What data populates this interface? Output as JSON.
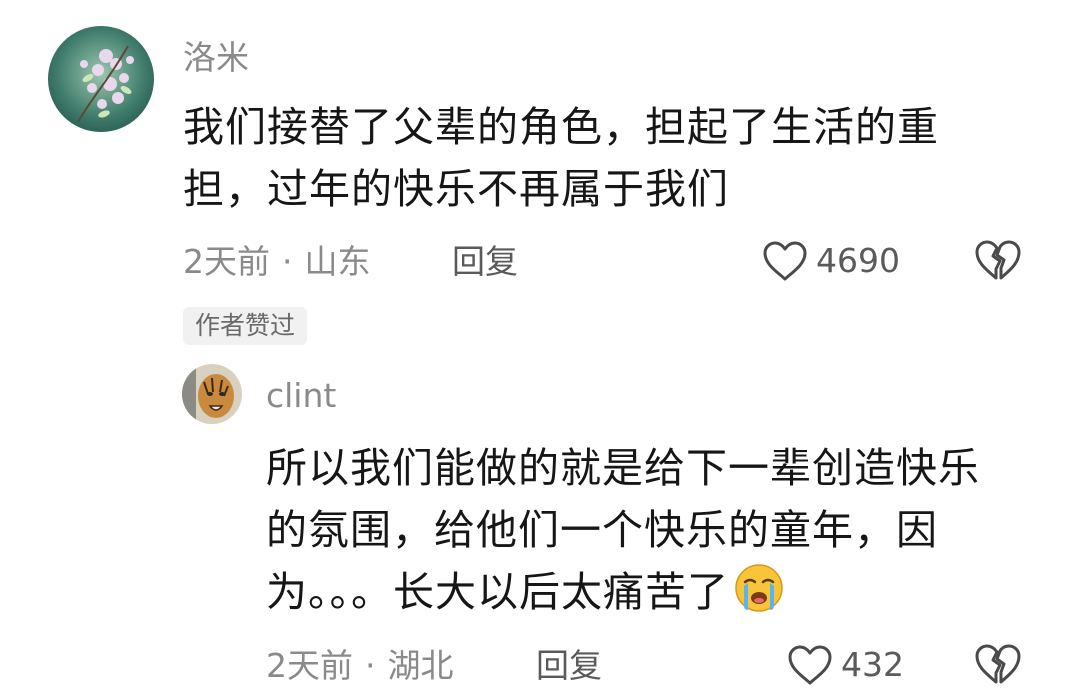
{
  "comments": [
    {
      "username": "洛米",
      "avatar_icon": "flower-avatar",
      "content_lines": [
        "我们接替了父辈的角色，担起了生活的重",
        "担，过年的快乐不再属于我们"
      ],
      "time": "2天前",
      "separator": "·",
      "location": "山东",
      "reply_label": "回复",
      "like_count": "4690",
      "badge": "作者赞过"
    },
    {
      "username": "clint",
      "avatar_icon": "tiger-avatar",
      "content_lines": [
        "所以我们能做的就是给下一辈创造快乐",
        "的氛围，给他们一个快乐的童年，因",
        "为。。。长大以后太痛苦了"
      ],
      "emoji_icon": "crying-face-icon",
      "time": "2天前",
      "separator": "·",
      "location": "湖北",
      "reply_label": "回复",
      "like_count": "432"
    }
  ],
  "icons": {
    "like": "heart-outline-icon",
    "dislike": "broken-heart-icon"
  }
}
